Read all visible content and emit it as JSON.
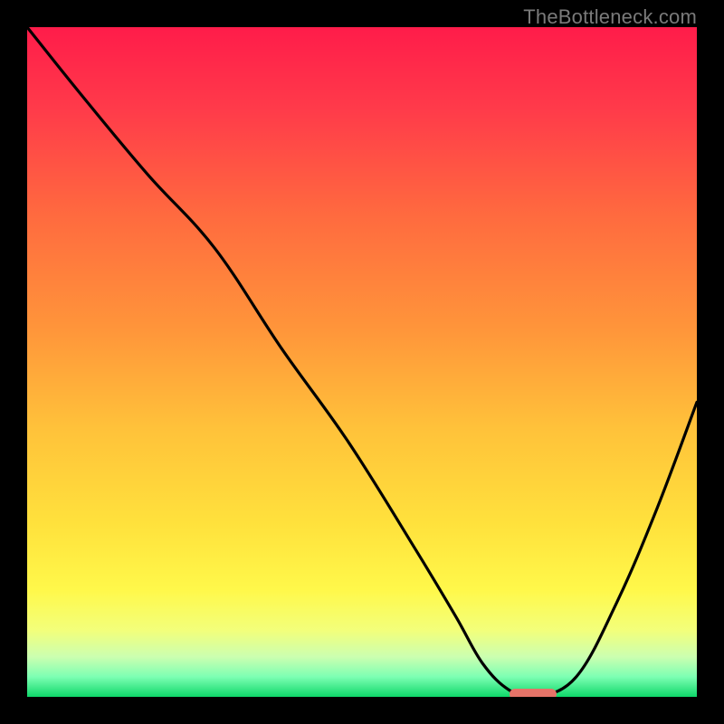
{
  "watermark": "TheBottleneck.com",
  "chart_data": {
    "type": "line",
    "title": "",
    "xlabel": "",
    "ylabel": "",
    "xlim": [
      0,
      100
    ],
    "ylim": [
      0,
      100
    ],
    "grid": false,
    "legend": false,
    "background_gradient_stops": [
      {
        "offset": 0.0,
        "color": "#ff1c4a"
      },
      {
        "offset": 0.12,
        "color": "#ff3a4a"
      },
      {
        "offset": 0.28,
        "color": "#ff6a3f"
      },
      {
        "offset": 0.45,
        "color": "#ff953a"
      },
      {
        "offset": 0.6,
        "color": "#ffc23a"
      },
      {
        "offset": 0.74,
        "color": "#ffe13c"
      },
      {
        "offset": 0.84,
        "color": "#fff84a"
      },
      {
        "offset": 0.9,
        "color": "#f3ff7a"
      },
      {
        "offset": 0.94,
        "color": "#ccffb0"
      },
      {
        "offset": 0.97,
        "color": "#7dffb3"
      },
      {
        "offset": 1.0,
        "color": "#0fd86a"
      }
    ],
    "series": [
      {
        "name": "bottleneck-curve",
        "color": "#000000",
        "x": [
          0,
          8,
          18,
          28,
          38,
          48,
          58,
          64,
          68,
          72,
          76,
          82,
          88,
          94,
          100
        ],
        "y": [
          100,
          90,
          78,
          67,
          52,
          38,
          22,
          12,
          5,
          1,
          0,
          3,
          14,
          28,
          44
        ]
      }
    ],
    "marker": {
      "name": "optimal-range",
      "color": "#e57368",
      "x_start": 72,
      "x_end": 79,
      "y": 0
    },
    "annotations": []
  }
}
